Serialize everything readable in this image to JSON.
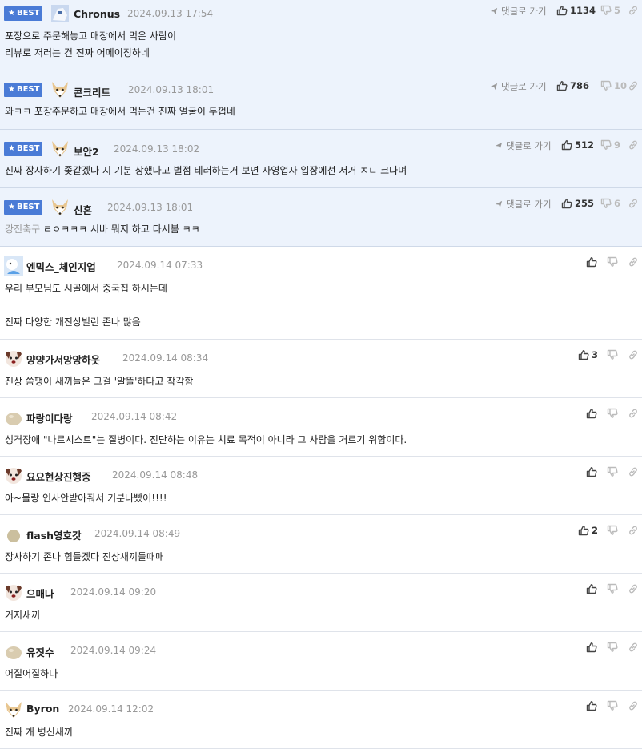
{
  "colors": {
    "best_bg": "#edf3fc",
    "badge": "#4a7bd6",
    "date": "#999999",
    "border": "#dfe3ea"
  },
  "best_badge_label": "BEST",
  "reply_label": "댓글로 가기",
  "best_comments": [
    {
      "nick": "Chronus",
      "date": "2024.09.13 17:54",
      "text": "포장으로 주문해놓고 매장에서 먹은 사람이\n리뷰로 저러는 건 진짜 어메이징하네",
      "up": "1134",
      "down": "5",
      "avatar": "robot-avatar"
    },
    {
      "nick": "콘크리트",
      "date": "2024.09.13 18:01",
      "text": "와ㅋㅋ 포장주문하고 매장에서 먹는건 진짜 얼굴이 두껍네",
      "up": "786",
      "down": "10",
      "avatar": "fox-avatar"
    },
    {
      "nick": "보안2",
      "date": "2024.09.13 18:02",
      "text": "진짜 장사하기 좆같겠다 지 기분 상했다고 별점 테러하는거 보면 자영업자 입장에선 저거 ㅈㄴ 크다며",
      "up": "512",
      "down": "9",
      "avatar": "fox-avatar"
    },
    {
      "nick": "신혼",
      "date": "2024.09.13 18:01",
      "prefix": "강진축구",
      "text": "ㄹㅇㅋㅋㅋ 시바 뭐지 하고 다시봄 ㅋㅋ",
      "up": "255",
      "down": "6",
      "avatar": "fox-avatar"
    }
  ],
  "comments": [
    {
      "nick": "엔믹스_체인지업",
      "date": "2024.09.14 07:33",
      "text": "우리 부모님도 시골에서 중국집 하시는데\n\n진짜 다양한 개진상빌런 존나 많음",
      "up": "",
      "avatar": "blue-avatar"
    },
    {
      "nick": "양양가서앙앙하읏",
      "date": "2024.09.14 08:34",
      "text": "진상 쫌팽이 새끼들은 그걸 '알뜰'하다고 착각함",
      "up": "3",
      "avatar": "dog-avatar"
    },
    {
      "nick": "파랑이다랑",
      "date": "2024.09.14 08:42",
      "text": "성격장애 \"나르시스트\"는 질병이다. 진단하는 이유는 치료 목적이 아니라 그 사람을 거르기 위함이다.",
      "up": "",
      "avatar": "blob-avatar"
    },
    {
      "nick": "요요현상진행중",
      "date": "2024.09.14 08:48",
      "text": "아~몰랑 인사안받아줘서 기분나빴어!!!!",
      "up": "",
      "avatar": "dog-avatar"
    },
    {
      "nick": "flash영호갓",
      "date": "2024.09.14 08:49",
      "text": "장사하기 존나 힘들겠다 진상새끼들때매",
      "up": "2",
      "avatar": "dot-avatar"
    },
    {
      "nick": "으매나",
      "date": "2024.09.14 09:20",
      "text": "거지새끼",
      "up": "",
      "avatar": "dog-avatar"
    },
    {
      "nick": "유짓수",
      "date": "2024.09.14 09:24",
      "text": "어질어질하다",
      "up": "",
      "avatar": "blob-avatar"
    },
    {
      "nick": "Byron",
      "date": "2024.09.14 12:02",
      "text": "진짜 개 병신새끼",
      "up": "",
      "avatar": "fox-avatar"
    }
  ]
}
